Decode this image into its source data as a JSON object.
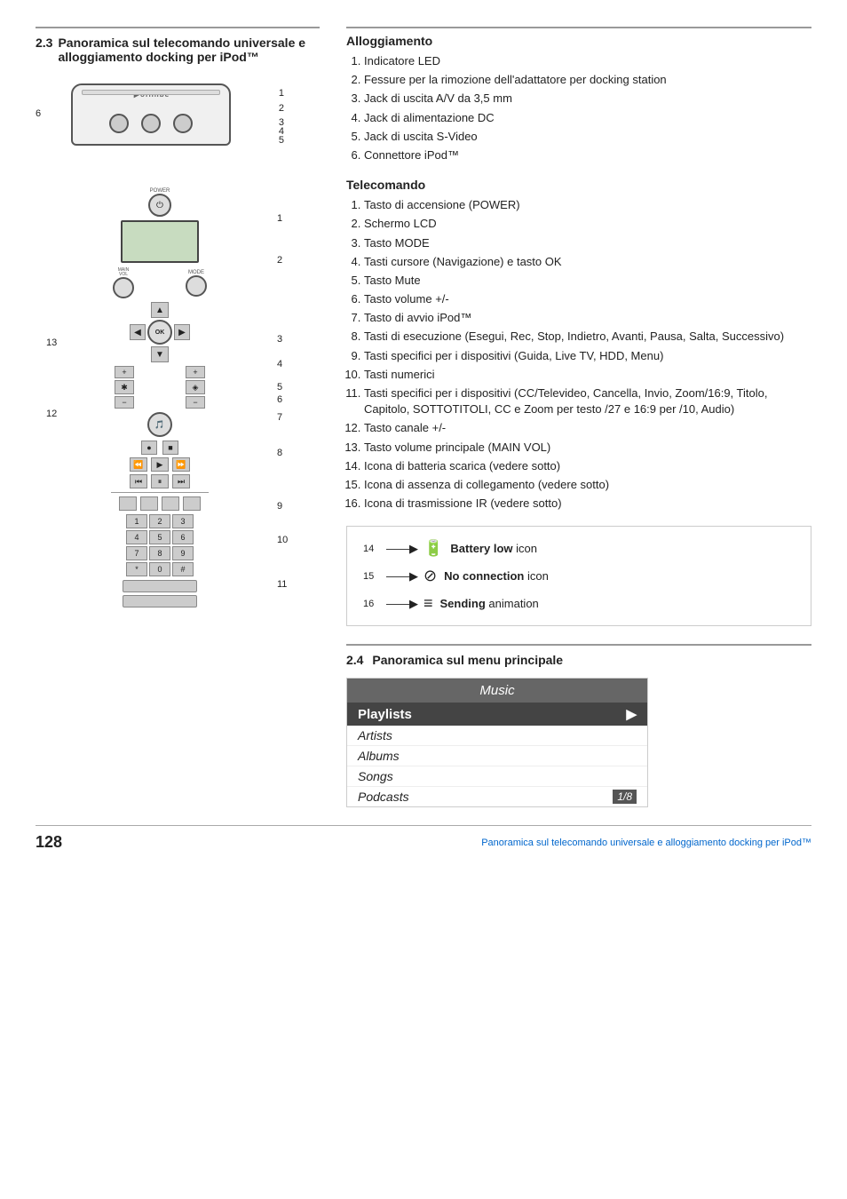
{
  "page": {
    "section": "2.3",
    "title": "Panoramica sul telecomando universale e alloggiamento docking per iPod™",
    "footer_page": "128",
    "footer_link": "Panoramica sul telecomando universale e alloggiamento docking per iPod™"
  },
  "docking": {
    "title": "Alloggiamento",
    "items": [
      "Indicatore LED",
      "Fessure per la rimozione dell'adattatore per docking station",
      "Jack di uscita A/V da 3,5 mm",
      "Jack di alimentazione DC",
      "Jack di uscita S-Video",
      "Connettore iPod™"
    ]
  },
  "remote": {
    "title": "Telecomando",
    "items": [
      "Tasto di accensione (POWER)",
      "Schermo LCD",
      "Tasto MODE",
      "Tasti cursore (Navigazione) e tasto OK",
      "Tasto Mute",
      "Tasto volume +/-",
      "Tasto di avvio iPod™",
      "Tasti di esecuzione (Esegui, Rec, Stop, Indietro, Avanti, Pausa, Salta, Successivo)",
      "Tasti specifici per i dispositivi (Guida, Live TV, HDD, Menu)",
      "Tasti numerici",
      "Tasti specifici per i dispositivi (CC/Televideo, Cancella, Invio, Zoom/16:9, Titolo, Capitolo, SOTTOTITOLI, CC e Zoom per testo /27 e 16:9 per /10, Audio)",
      "Tasto canale +/-",
      "Tasto volume principale (MAIN VOL)",
      "Icona di batteria scarica (vedere sotto)",
      "Icona di assenza di collegamento (vedere sotto)",
      "Icona di trasmissione IR (vedere sotto)"
    ]
  },
  "icons": {
    "title": "Battery low icon No connection icon Sending animation",
    "rows": [
      {
        "number": "14",
        "symbol": "🔋",
        "bold": "Battery low",
        "rest": " icon"
      },
      {
        "number": "15",
        "symbol": "⊘",
        "bold": "No connection",
        "rest": " icon"
      },
      {
        "number": "16",
        "symbol": "≡",
        "bold": "Sending",
        "rest": " animation"
      }
    ]
  },
  "menu": {
    "section": "2.4",
    "title": "Panoramica sul menu principale",
    "title_bar": "Music",
    "items": [
      {
        "label": "Playlists",
        "selected": true,
        "arrow": "▶"
      },
      {
        "label": "Artists",
        "selected": false
      },
      {
        "label": "Albums",
        "selected": false
      },
      {
        "label": "Songs",
        "selected": false
      },
      {
        "label": "Podcasts",
        "selected": false,
        "badge": "1/8"
      }
    ]
  },
  "remote_labels": {
    "power": "POWER",
    "main_vol": "MAIN VOL",
    "mode": "MODE",
    "ok": "OK"
  },
  "numpad": [
    "1",
    "2",
    "3",
    "4",
    "5",
    "6",
    "7",
    "8",
    "9",
    "*",
    "0",
    "#"
  ]
}
